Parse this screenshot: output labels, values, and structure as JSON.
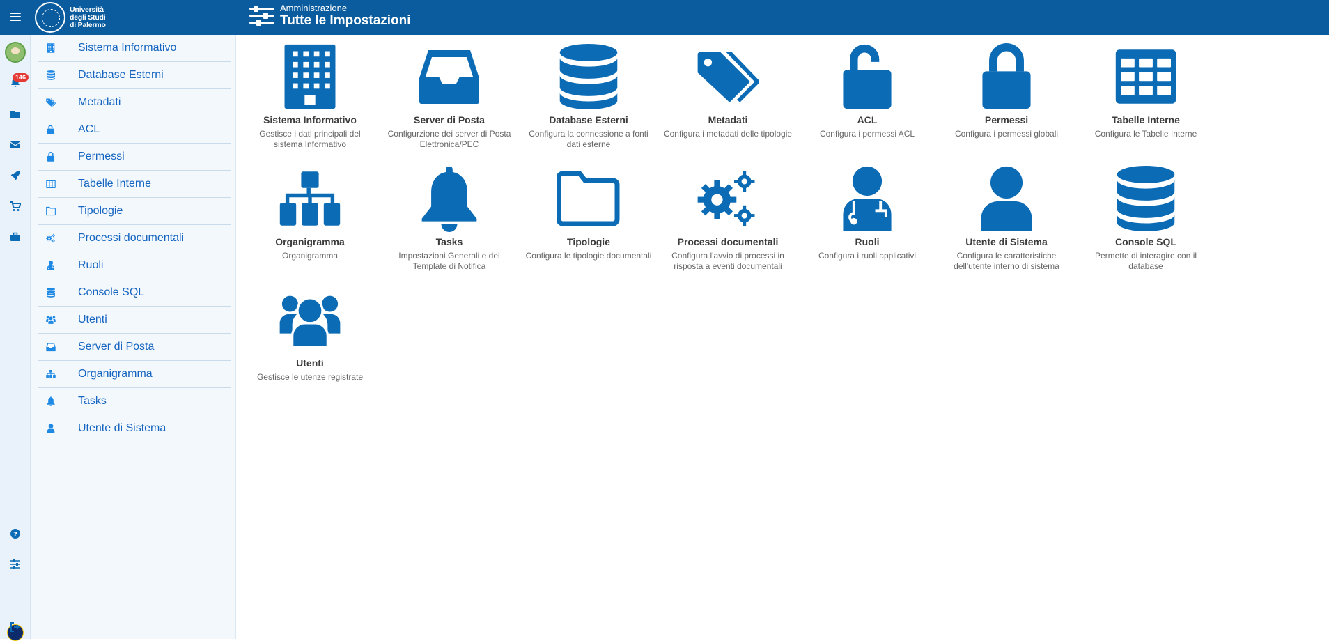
{
  "header": {
    "subtitle": "Amministrazione",
    "title": "Tutte le Impostazioni",
    "logo_lines": [
      "Università",
      "degli Studi",
      "di Palermo"
    ]
  },
  "rail": {
    "notification_count": "146"
  },
  "sidebar": {
    "items": [
      {
        "label": "Sistema Informativo",
        "icon": "building-icon"
      },
      {
        "label": "Database Esterni",
        "icon": "database-icon"
      },
      {
        "label": "Metadati",
        "icon": "tags-icon"
      },
      {
        "label": "ACL",
        "icon": "unlock-icon"
      },
      {
        "label": "Permessi",
        "icon": "lock-icon"
      },
      {
        "label": "Tabelle Interne",
        "icon": "table-icon"
      },
      {
        "label": "Tipologie",
        "icon": "folder-icon"
      },
      {
        "label": "Processi documentali",
        "icon": "cogs-icon"
      },
      {
        "label": "Ruoli",
        "icon": "user-md-icon"
      },
      {
        "label": "Console SQL",
        "icon": "database-icon"
      },
      {
        "label": "Utenti",
        "icon": "users-icon"
      },
      {
        "label": "Server di Posta",
        "icon": "inbox-icon"
      },
      {
        "label": "Organigramma",
        "icon": "sitemap-icon"
      },
      {
        "label": "Tasks",
        "icon": "bell-icon"
      },
      {
        "label": "Utente di Sistema",
        "icon": "user-icon"
      }
    ]
  },
  "cards": [
    {
      "title": "Sistema Informativo",
      "desc": "Gestisce i dati principali del sistema Informativo",
      "icon": "building-icon"
    },
    {
      "title": "Server di Posta",
      "desc": "Configurzione dei server di Posta Elettronica/PEC",
      "icon": "inbox-icon"
    },
    {
      "title": "Database Esterni",
      "desc": "Configura la connessione a fonti dati esterne",
      "icon": "database-icon"
    },
    {
      "title": "Metadati",
      "desc": "Configura i metadati delle tipologie",
      "icon": "tags-icon"
    },
    {
      "title": "ACL",
      "desc": "Configura i permessi ACL",
      "icon": "unlock-icon"
    },
    {
      "title": "Permessi",
      "desc": "Configura i permessi globali",
      "icon": "lock-icon"
    },
    {
      "title": "Tabelle Interne",
      "desc": "Configura le Tabelle Interne",
      "icon": "table-icon"
    },
    {
      "title": "Organigramma",
      "desc": "Organigramma",
      "icon": "sitemap-icon"
    },
    {
      "title": "Tasks",
      "desc": "Impostazioni Generali e dei Template di Notifica",
      "icon": "bell-icon"
    },
    {
      "title": "Tipologie",
      "desc": "Configura le tipologie documentali",
      "icon": "folder-icon"
    },
    {
      "title": "Processi documentali",
      "desc": "Configura l'avvio di processi in risposta a eventi documentali",
      "icon": "cogs-icon"
    },
    {
      "title": "Ruoli",
      "desc": "Configura i ruoli applicativi",
      "icon": "user-md-icon"
    },
    {
      "title": "Utente di Sistema",
      "desc": "Configura le caratteristiche dell'utente interno di sistema",
      "icon": "user-icon"
    },
    {
      "title": "Console SQL",
      "desc": "Permette di interagire con il database",
      "icon": "database-icon"
    },
    {
      "title": "Utenti",
      "desc": "Gestisce le utenze registrate",
      "icon": "users-icon"
    }
  ],
  "colors": {
    "topbar": "#0b5c9e",
    "accent": "#0b6bb5",
    "sidebar_text": "#1565c0",
    "badge": "#e53935"
  }
}
